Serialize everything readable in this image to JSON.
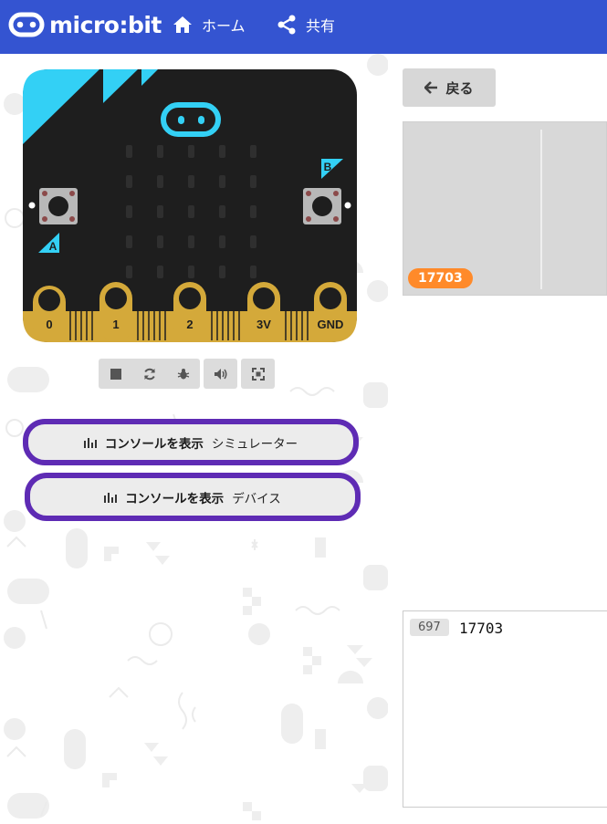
{
  "topbar": {
    "logo_text": "micro:bit",
    "home_label": "ホーム",
    "share_label": "共有"
  },
  "board": {
    "button_a": "A",
    "button_b": "B",
    "pins": [
      "0",
      "1",
      "2",
      "3V",
      "GND"
    ]
  },
  "console_buttons": [
    {
      "label": "コンソールを表示",
      "target": "シミュレーター"
    },
    {
      "label": "コンソールを表示",
      "target": "デバイス"
    }
  ],
  "back_label": "戻る",
  "chart": {
    "badge_value": "17703"
  },
  "log": {
    "count": "697",
    "value": "17703"
  },
  "colors": {
    "topbar": "#3454d1",
    "accent_purple": "#5e2bb4",
    "badge_orange": "#ff8a2a",
    "board_black": "#1e1e1e",
    "board_cyan": "#33d0f5",
    "pin_gold": "#d4a93a"
  }
}
